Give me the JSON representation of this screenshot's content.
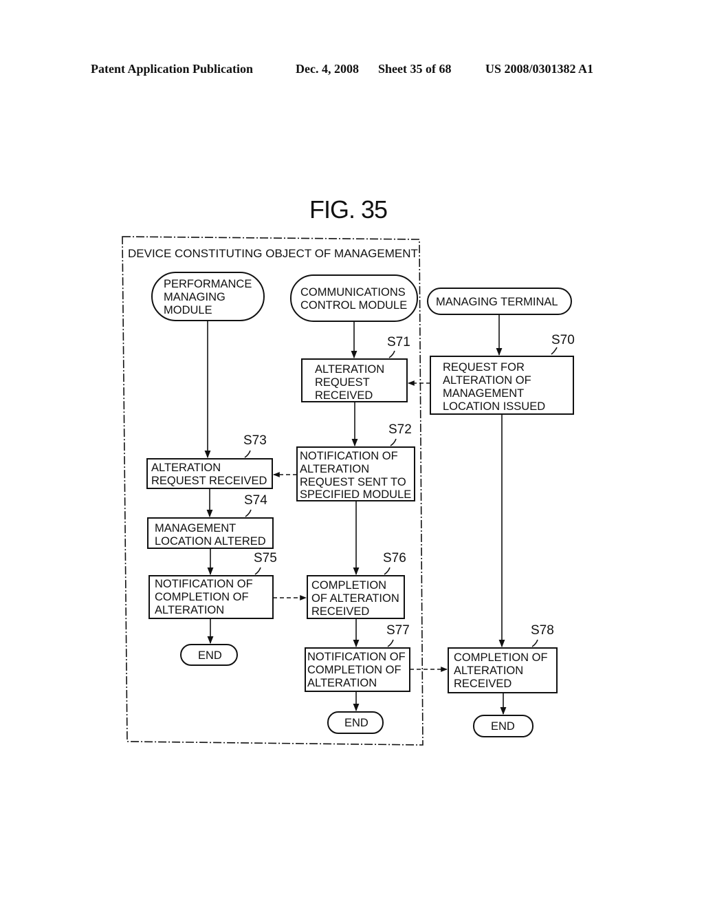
{
  "header": {
    "publication": "Patent Application Publication",
    "date": "Dec. 4, 2008",
    "sheet": "Sheet 35 of 68",
    "patent_number": "US 2008/0301382 A1"
  },
  "figure": {
    "title": "FIG. 35",
    "group_label": "DEVICE CONSTITUTING OBJECT OF MANAGEMENT",
    "lanes": [
      {
        "id": "pm",
        "lines": [
          "PERFORMANCE",
          "MANAGING",
          "MODULE"
        ]
      },
      {
        "id": "cc",
        "lines": [
          "COMMUNICATIONS",
          "CONTROL MODULE"
        ]
      },
      {
        "id": "mt",
        "lines": [
          "MANAGING TERMINAL"
        ]
      }
    ],
    "steps": [
      {
        "id": "S70",
        "label": "S70",
        "lines": [
          "REQUEST FOR",
          "ALTERATION OF",
          "MANAGEMENT",
          "LOCATION ISSUED"
        ]
      },
      {
        "id": "S71",
        "label": "S71",
        "lines": [
          "ALTERATION",
          "REQUEST",
          "RECEIVED"
        ]
      },
      {
        "id": "S72",
        "label": "S72",
        "lines": [
          "NOTIFICATION OF",
          "ALTERATION",
          "REQUEST SENT TO",
          "SPECIFIED MODULE"
        ]
      },
      {
        "id": "S73",
        "label": "S73",
        "lines": [
          "ALTERATION",
          "REQUEST RECEIVED"
        ]
      },
      {
        "id": "S74",
        "label": "S74",
        "lines": [
          "MANAGEMENT",
          "LOCATION ALTERED"
        ]
      },
      {
        "id": "S75",
        "label": "S75",
        "lines": [
          "NOTIFICATION OF",
          "COMPLETION OF",
          "ALTERATION"
        ]
      },
      {
        "id": "S76",
        "label": "S76",
        "lines": [
          "COMPLETION",
          "OF ALTERATION",
          "RECEIVED"
        ]
      },
      {
        "id": "S77",
        "label": "S77",
        "lines": [
          "NOTIFICATION OF",
          "COMPLETION OF",
          "ALTERATION"
        ]
      },
      {
        "id": "S78",
        "label": "S78",
        "lines": [
          "COMPLETION OF",
          "ALTERATION",
          "RECEIVED"
        ]
      }
    ],
    "end_label": "END"
  }
}
